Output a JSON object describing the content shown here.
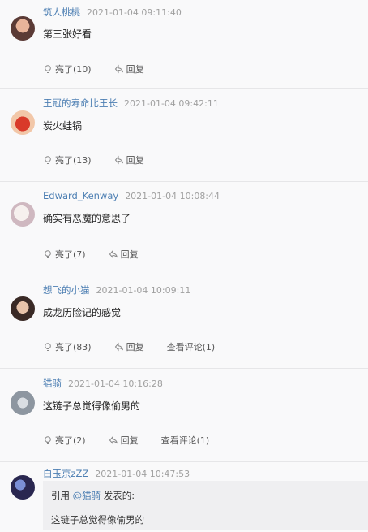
{
  "comments": [
    {
      "user": "筑人桃桃",
      "time": "2021-01-04 09:11:40",
      "text": "第三张好看",
      "like": "亮了(10)",
      "reply": "回复",
      "view": ""
    },
    {
      "user": "王冠的寿命比王长",
      "time": "2021-01-04 09:42:11",
      "text": "炭火蛙锅",
      "like": "亮了(13)",
      "reply": "回复",
      "view": ""
    },
    {
      "user": "Edward_Kenway",
      "time": "2021-01-04 10:08:44",
      "text": "确实有恶魔的意思了",
      "like": "亮了(7)",
      "reply": "回复",
      "view": ""
    },
    {
      "user": "想飞的小猫",
      "time": "2021-01-04 10:09:11",
      "text": "成龙历险记的感觉",
      "like": "亮了(83)",
      "reply": "回复",
      "view": "查看评论(1)"
    },
    {
      "user": "猫骑",
      "time": "2021-01-04 10:16:28",
      "text": "这链子总觉得像偷男的",
      "like": "亮了(2)",
      "reply": "回复",
      "view": "查看评论(1)"
    },
    {
      "user": "白玉京zZZ",
      "time": "2021-01-04 10:47:53",
      "text": "",
      "like": "",
      "reply": "",
      "view": ""
    }
  ],
  "quote": {
    "prefix": "引用 ",
    "mention": "@猫骑",
    "suffix": " 发表的:",
    "text": "这链子总觉得像偷男的"
  },
  "colors": {
    "username": "#4d7fb3",
    "time": "#a0a0a0",
    "divider": "#e6e6e8"
  }
}
